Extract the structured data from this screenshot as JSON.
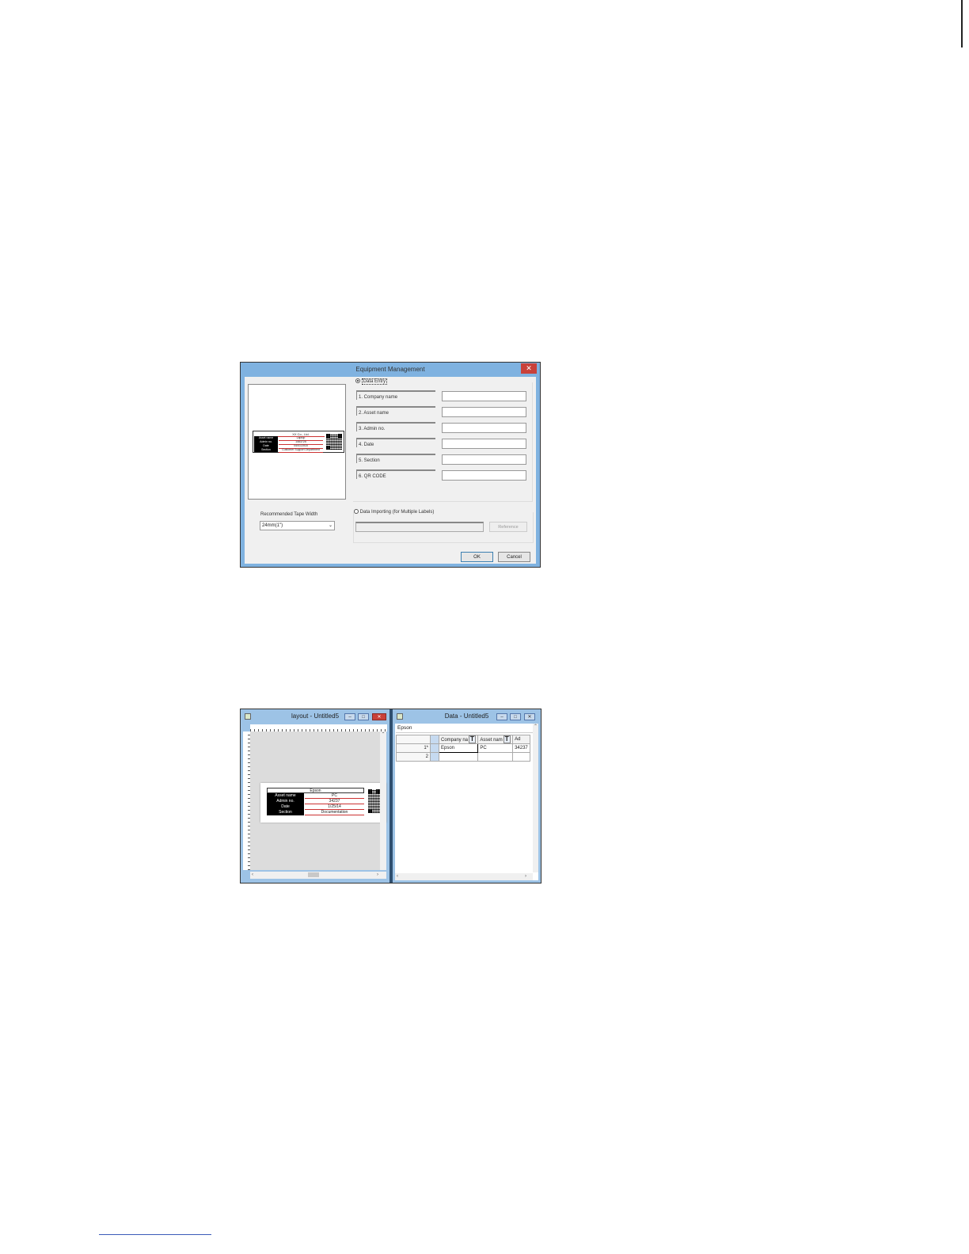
{
  "dialog": {
    "title": "Equipment Management",
    "close_glyph": "✕",
    "preview_label": {
      "header": "XX Co., Ltd.",
      "rows": [
        {
          "label": "Asset name",
          "value": "Laptop"
        },
        {
          "label": "Admin no.",
          "value": "1463725"
        },
        {
          "label": "Date",
          "value": "04/01/2015"
        },
        {
          "label": "Section",
          "value": "Customer Support Department"
        }
      ]
    },
    "data_entry_label": "Data Entry",
    "fields": [
      {
        "label": "1. Company name",
        "value": ""
      },
      {
        "label": "2. Asset name",
        "value": ""
      },
      {
        "label": "3. Admin no.",
        "value": ""
      },
      {
        "label": "4. Date",
        "value": ""
      },
      {
        "label": "5. Section",
        "value": ""
      },
      {
        "label": "6. QR CODE",
        "value": ""
      }
    ],
    "tape_width_label": "Recommended Tape Width",
    "tape_width_value": "24mm(1\")",
    "data_import_label": "Data Importing (for Multiple Labels)",
    "reference_label": "Reference",
    "ok_label": "OK",
    "cancel_label": "Cancel"
  },
  "layout_window": {
    "title": "layout - Untitled5",
    "label": {
      "header": "Epson",
      "rows": [
        {
          "label": "Asset name",
          "value": "PC"
        },
        {
          "label": "Admin no.",
          "value": "34237"
        },
        {
          "label": "Date",
          "value": "1/25/14"
        },
        {
          "label": "Section",
          "value": "Documentation"
        }
      ]
    }
  },
  "data_window": {
    "title": "Data - Untitled5",
    "input_value": "Epson",
    "columns": [
      "Company na",
      "Asset nam",
      "Ad"
    ],
    "rows": [
      {
        "num": "1*",
        "cells": [
          "Epson",
          "PC",
          "34237"
        ]
      },
      {
        "num": "2",
        "cells": [
          "",
          "",
          ""
        ]
      }
    ]
  }
}
